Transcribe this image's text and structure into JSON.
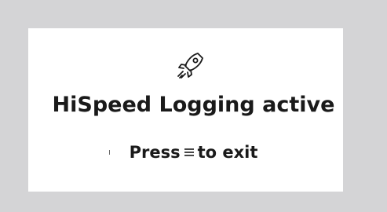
{
  "overlay": {
    "title": "HiSpeed Logging active",
    "hint_prefix": "Press",
    "hint_suffix": "to exit",
    "icon": "rocket-icon",
    "exit_key_icon": "menu-icon",
    "colors": {
      "backdrop": "#d4d4d6",
      "card": "#ffffff",
      "text": "#1a1a1a"
    }
  }
}
